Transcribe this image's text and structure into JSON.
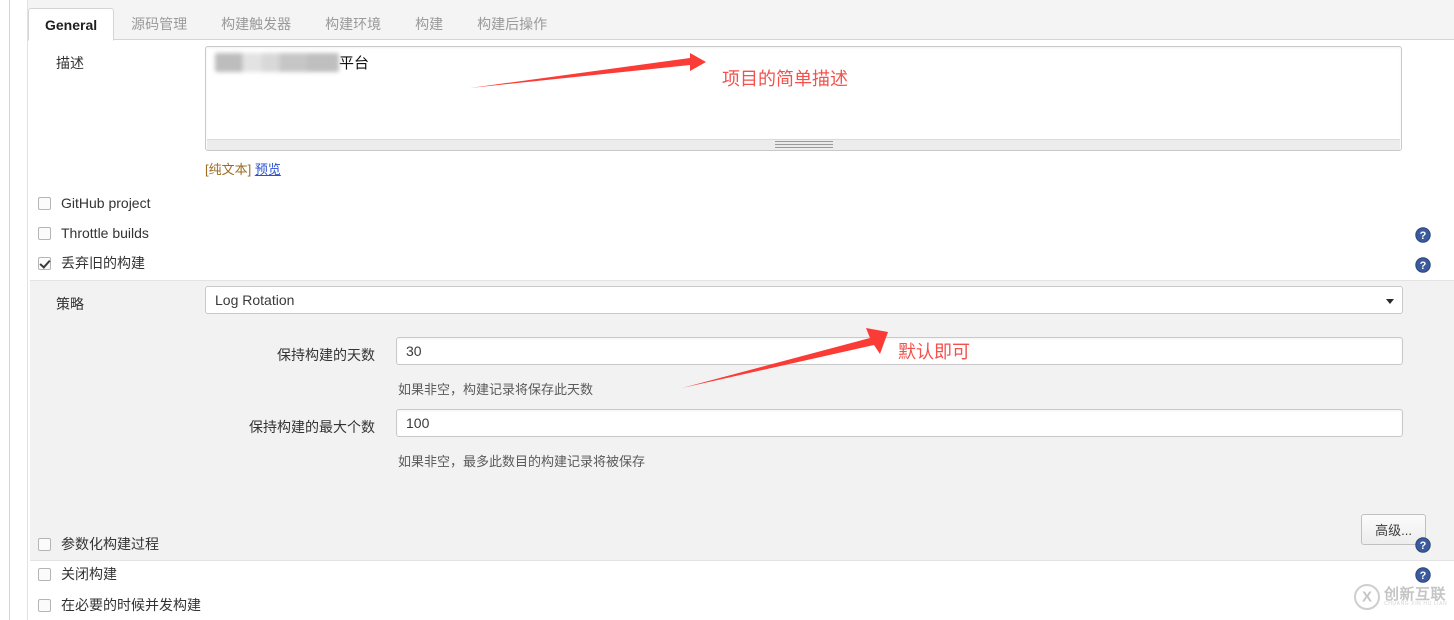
{
  "tabs": [
    {
      "label": "General",
      "active": true
    },
    {
      "label": "源码管理",
      "active": false
    },
    {
      "label": "构建触发器",
      "active": false
    },
    {
      "label": "构建环境",
      "active": false
    },
    {
      "label": "构建",
      "active": false
    },
    {
      "label": "构建后操作",
      "active": false
    }
  ],
  "description": {
    "label": "描述",
    "value_suffix": "平台",
    "value_redacted": true,
    "plain_text_label": "[纯文本]",
    "preview_link": "预览"
  },
  "checkboxes_top": [
    {
      "label": "GitHub project",
      "checked": false,
      "help": true
    },
    {
      "label": "Throttle builds",
      "checked": false,
      "help": true
    },
    {
      "label": "丢弃旧的构建",
      "checked": true,
      "help": true
    }
  ],
  "discard_builds": {
    "strategy_label": "策略",
    "strategy_value": "Log Rotation",
    "days_label": "保持构建的天数",
    "days_value": "30",
    "days_hint": "如果非空，构建记录将保存此天数",
    "max_label": "保持构建的最大个数",
    "max_value": "100",
    "max_hint": "如果非空，最多此数目的构建记录将被保存",
    "advanced_button": "高级..."
  },
  "checkboxes_bottom": [
    {
      "label": "参数化构建过程",
      "checked": false,
      "help": true
    },
    {
      "label": "关闭构建",
      "checked": false,
      "help": true
    },
    {
      "label": "在必要的时候并发构建",
      "checked": false,
      "help": false
    }
  ],
  "annotations": [
    {
      "text": "项目的简单描述",
      "color": "#f4514c"
    },
    {
      "text": "默认即可",
      "color": "#f4514c"
    }
  ],
  "watermark": {
    "cn": "创新互联",
    "en": "CHUANG XIN HU LIAN"
  },
  "colors": {
    "accent_red": "#f4514c",
    "link_blue": "#2a4fd1",
    "panel_gray": "#f2f2f2",
    "help_blue": "#3b5b9e"
  }
}
